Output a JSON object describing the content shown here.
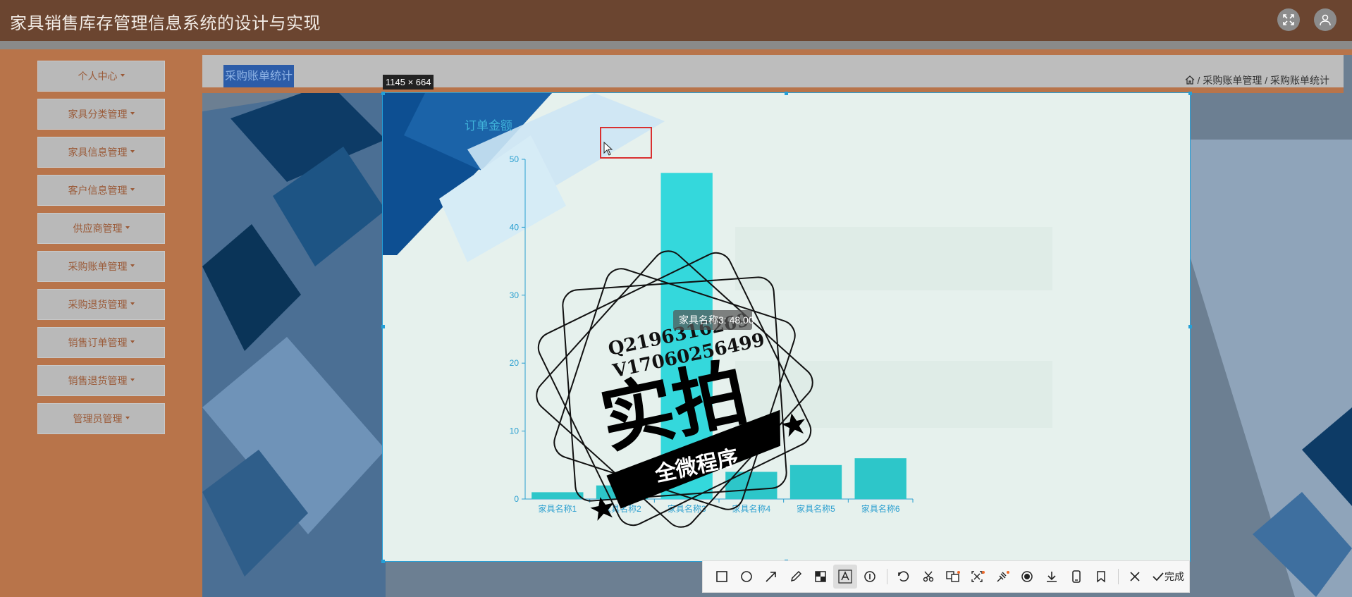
{
  "app": {
    "title": "家具销售库存管理信息系统的设计与实现"
  },
  "header_icons": {
    "fullscreen": "fullscreen-icon",
    "user": "user-icon"
  },
  "sidebar": {
    "items": [
      {
        "label": "个人中心"
      },
      {
        "label": "家具分类管理"
      },
      {
        "label": "家具信息管理"
      },
      {
        "label": "客户信息管理"
      },
      {
        "label": "供应商管理"
      },
      {
        "label": "采购账单管理"
      },
      {
        "label": "采购退货管理"
      },
      {
        "label": "销售订单管理"
      },
      {
        "label": "销售退货管理"
      },
      {
        "label": "管理员管理"
      }
    ]
  },
  "page": {
    "tab_label": "采购账单统计",
    "breadcrumb": {
      "home_icon": "home-icon",
      "items": [
        "采购账单管理",
        "采购账单统计"
      ],
      "separator": "/"
    }
  },
  "screenshot_tool": {
    "size_label": "1145 × 664",
    "tools": [
      "rectangle",
      "circle",
      "arrow",
      "pen",
      "mosaic",
      "text",
      "number",
      "undo",
      "crop",
      "translate",
      "ocr",
      "pin",
      "record",
      "download",
      "phone",
      "bookmark",
      "close",
      "done"
    ],
    "active_tool": "text",
    "done_label": "完成"
  },
  "watermark": {
    "line1": "Q2196316269",
    "line2": "V17060256499",
    "big": "实拍",
    "ribbon": "全微程序"
  },
  "colors": {
    "topbar": "#6b4530",
    "sidebar": "#b8744a",
    "bar": "#2dc6c9",
    "bar_highlight": "#34d8dc",
    "axis": "#2a9fd0"
  },
  "chart_data": {
    "type": "bar",
    "title": "订单金额",
    "categories": [
      "家具名称1",
      "家具名称2",
      "家具名称3",
      "家具名称4",
      "家具名称5",
      "家具名称6"
    ],
    "values": [
      1,
      2,
      48,
      4,
      5,
      6
    ],
    "ylim": [
      0,
      50
    ],
    "yticks": [
      0,
      10,
      20,
      30,
      40,
      50
    ],
    "highlighted_index": 2,
    "tooltip": "家具名称3: 48.00",
    "grid": false
  }
}
